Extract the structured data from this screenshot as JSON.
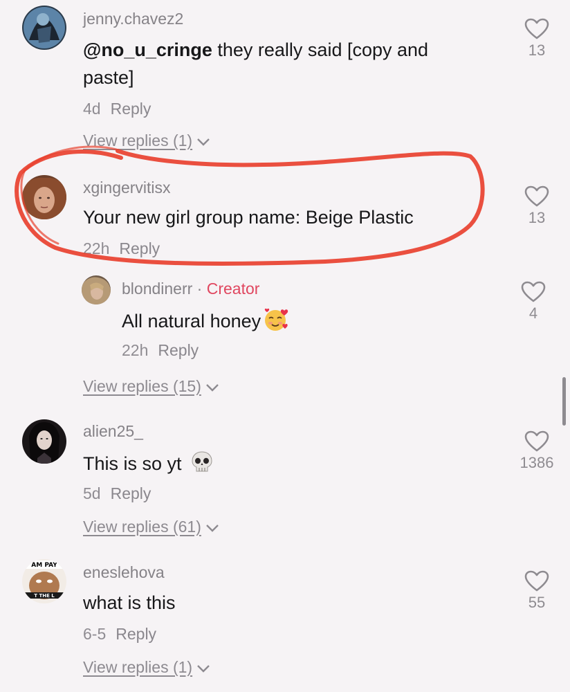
{
  "comments": [
    {
      "username": "jenny.chavez2",
      "mention": "@no_u_cringe",
      "text": " they really said [copy and paste]",
      "time": "4d",
      "reply_label": "Reply",
      "likes": "13",
      "view_replies": "View replies (1)"
    },
    {
      "username": "xgingervitisx",
      "text": "Your new girl group name: Beige Plastic",
      "time": "22h",
      "reply_label": "Reply",
      "likes": "13"
    },
    {
      "username": "blondinerr",
      "creator_sep": " · ",
      "creator_badge": "Creator",
      "text": "All natural honey",
      "time": "22h",
      "reply_label": "Reply",
      "likes": "4",
      "view_replies": "View replies (15)"
    },
    {
      "username": "alien25_",
      "text": "This is so yt",
      "time": "5d",
      "reply_label": "Reply",
      "likes": "1386",
      "view_replies": "View replies (61)"
    },
    {
      "username": "eneslehova",
      "text": "what is this",
      "time": "6-5",
      "reply_label": "Reply",
      "likes": "55",
      "view_replies": "View replies (1)"
    }
  ],
  "avatar_texts": {
    "eneslehova_top": "AM PAY",
    "eneslehova_bottom": "T THE L"
  },
  "colors": {
    "creator": "#e0465f",
    "highlight_circle": "#e8412f",
    "background": "#f6f3f5"
  }
}
